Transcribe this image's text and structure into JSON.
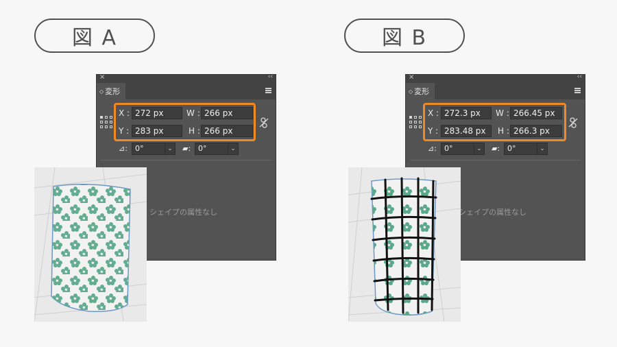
{
  "figures": [
    {
      "label": "図 A",
      "panel": {
        "tab_title": "変形",
        "x_label": "X",
        "y_label": "Y",
        "w_label": "W",
        "h_label": "H",
        "x_value": "272 px",
        "y_value": "283 px",
        "w_value": "266 px",
        "h_value": "266 px",
        "angle_value": "0°",
        "shear_value": "0°",
        "no_shape_text": "シェイプの属性なし"
      },
      "pattern": "flowers"
    },
    {
      "label": "図 B",
      "panel": {
        "tab_title": "変形",
        "x_label": "X",
        "y_label": "Y",
        "w_label": "W",
        "h_label": "H",
        "x_value": "272.3 px",
        "y_value": "283.48 px",
        "w_value": "266.45 px",
        "h_value": "266.3 px",
        "angle_value": "0°",
        "shear_value": "0°",
        "no_shape_text": "シェイプの属性なし"
      },
      "pattern": "flowers-with-grid-lines"
    }
  ],
  "colors": {
    "highlight": "#f08a24",
    "panel_bg": "#535353",
    "flower": "#5aa88c"
  }
}
